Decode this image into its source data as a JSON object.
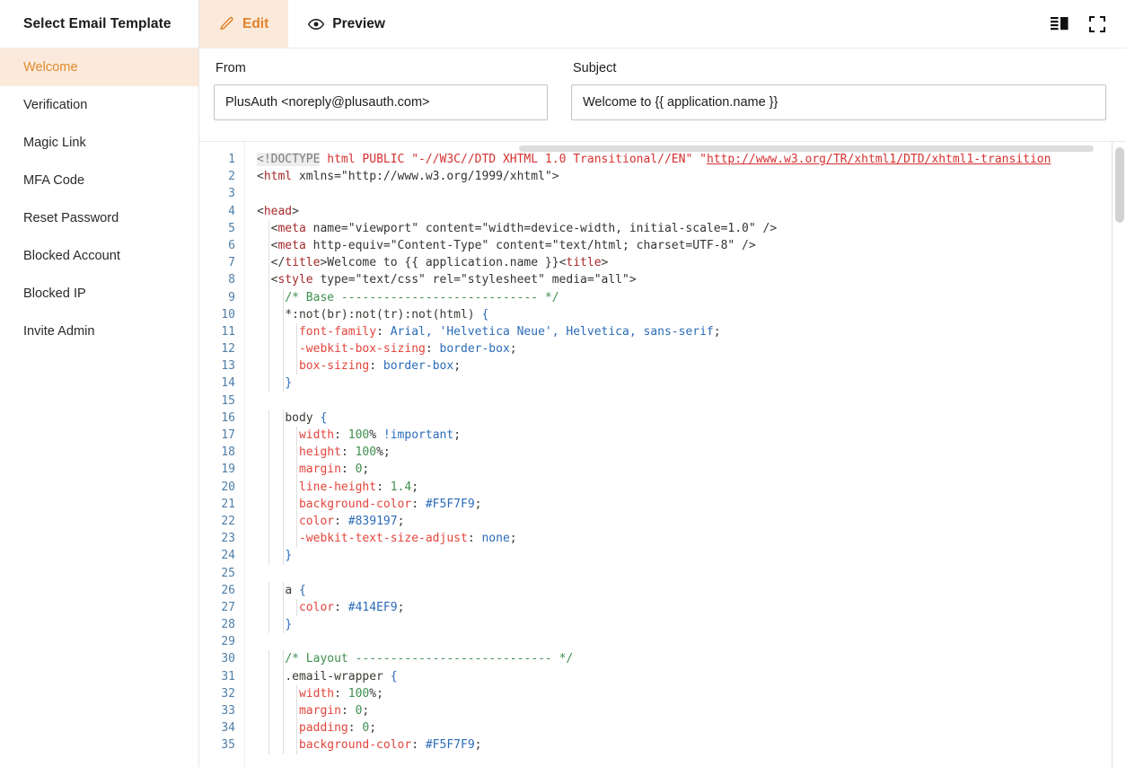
{
  "sidebar": {
    "title": "Select Email Template",
    "items": [
      {
        "label": "Welcome",
        "active": true
      },
      {
        "label": "Verification",
        "active": false
      },
      {
        "label": "Magic Link",
        "active": false
      },
      {
        "label": "MFA Code",
        "active": false
      },
      {
        "label": "Reset Password",
        "active": false
      },
      {
        "label": "Blocked Account",
        "active": false
      },
      {
        "label": "Blocked IP",
        "active": false
      },
      {
        "label": "Invite Admin",
        "active": false
      }
    ]
  },
  "tabs": [
    {
      "label": "Edit",
      "icon": "pencil-icon",
      "active": true
    },
    {
      "label": "Preview",
      "icon": "eye-icon",
      "active": false
    }
  ],
  "tools": [
    {
      "name": "split-view-icon"
    },
    {
      "name": "fullscreen-icon"
    }
  ],
  "fields": {
    "from": {
      "label": "From",
      "value": "PlusAuth <noreply@plusauth.com>",
      "placeholder": "From"
    },
    "subject": {
      "label": "Subject",
      "value": "Welcome to {{ application.name }}",
      "placeholder": "Subject"
    }
  },
  "editor": {
    "first_line": 1,
    "last_line": 35,
    "line_numbers": [
      1,
      2,
      3,
      4,
      5,
      6,
      7,
      8,
      9,
      10,
      11,
      12,
      13,
      14,
      15,
      16,
      17,
      18,
      19,
      20,
      21,
      22,
      23,
      24,
      25,
      26,
      27,
      28,
      29,
      30,
      31,
      32,
      33,
      34,
      35
    ],
    "lines": [
      "<!DOCTYPE html PUBLIC \"-//W3C//DTD XHTML 1.0 Transitional//EN\" \"http://www.w3.org/TR/xhtml1/DTD/xhtml1-transition",
      "<html xmlns=\"http://www.w3.org/1999/xhtml\">",
      "",
      "<head>",
      "  <meta name=\"viewport\" content=\"width=device-width, initial-scale=1.0\" />",
      "  <meta http-equiv=\"Content-Type\" content=\"text/html; charset=UTF-8\" />",
      "  <title>Welcome to {{ application.name }}</title>",
      "  <style type=\"text/css\" rel=\"stylesheet\" media=\"all\">",
      "    /* Base ---------------------------- */",
      "    *:not(br):not(tr):not(html) {",
      "      font-family: Arial, 'Helvetica Neue', Helvetica, sans-serif;",
      "      -webkit-box-sizing: border-box;",
      "      box-sizing: border-box;",
      "    }",
      "",
      "    body {",
      "      width: 100% !important;",
      "      height: 100%;",
      "      margin: 0;",
      "      line-height: 1.4;",
      "      background-color: #F5F7F9;",
      "      color: #839197;",
      "      -webkit-text-size-adjust: none;",
      "    }",
      "",
      "    a {",
      "      color: #414EF9;",
      "    }",
      "",
      "    /* Layout ---------------------------- */",
      "    .email-wrapper {",
      "      width: 100%;",
      "      margin: 0;",
      "      padding: 0;",
      "      background-color: #F5F7F9;"
    ]
  },
  "colors": {
    "accent": "#e0832a",
    "accent_bg": "#fbeadb",
    "border": "#e6e6e6",
    "text": "#1b1b1b",
    "linenum": "#4f7ea8"
  }
}
